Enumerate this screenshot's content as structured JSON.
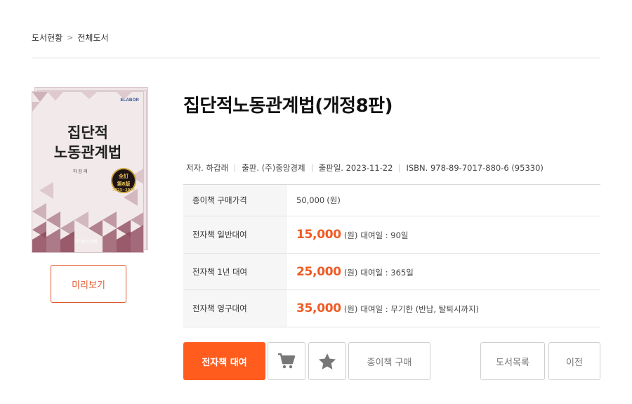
{
  "breadcrumb": {
    "items": [
      "도서현황",
      "전체도서"
    ],
    "separator": ">"
  },
  "cover": {
    "brand": "ELABOR",
    "title_line1": "집단적",
    "title_line2": "노동관계법",
    "author": "하 갑 래",
    "seal_line1": "全訂",
    "seal_line2": "第8版",
    "seal_line3": "2023~2024",
    "publisher": "(주)중앙경제"
  },
  "preview_label": "미리보기",
  "book": {
    "title": "집단적노동관계법(개정8판)",
    "meta": {
      "author": "저자. 하갑래",
      "publisher": "출판. (주)중앙경제",
      "date": "출판일. 2023-11-22",
      "isbn": "ISBN. 978-89-7017-880-6 (95330)"
    }
  },
  "prices": [
    {
      "label": "종이책 구매가격",
      "amount": "50,000",
      "unit": "(원)",
      "note": ""
    },
    {
      "label": "전자책 일반대여",
      "amount": "15,000",
      "unit": "(원)",
      "note": "대여일 : 90일"
    },
    {
      "label": "전자책 1년 대여",
      "amount": "25,000",
      "unit": "(원)",
      "note": "대여일 : 365일"
    },
    {
      "label": "전자책 영구대여",
      "amount": "35,000",
      "unit": "(원)",
      "note": "대여일 : 무기한 (반납, 탈퇴시까지)"
    }
  ],
  "actions": {
    "rent": "전자책 대여",
    "cart_icon": "cart-icon",
    "star_icon": "star-icon",
    "paper": "종이책 구매",
    "list": "도서목록",
    "prev": "이전"
  },
  "colors": {
    "accent": "#ff5c1e",
    "price": "#ef5b24",
    "cover_pattern": "#8f4a5e"
  }
}
